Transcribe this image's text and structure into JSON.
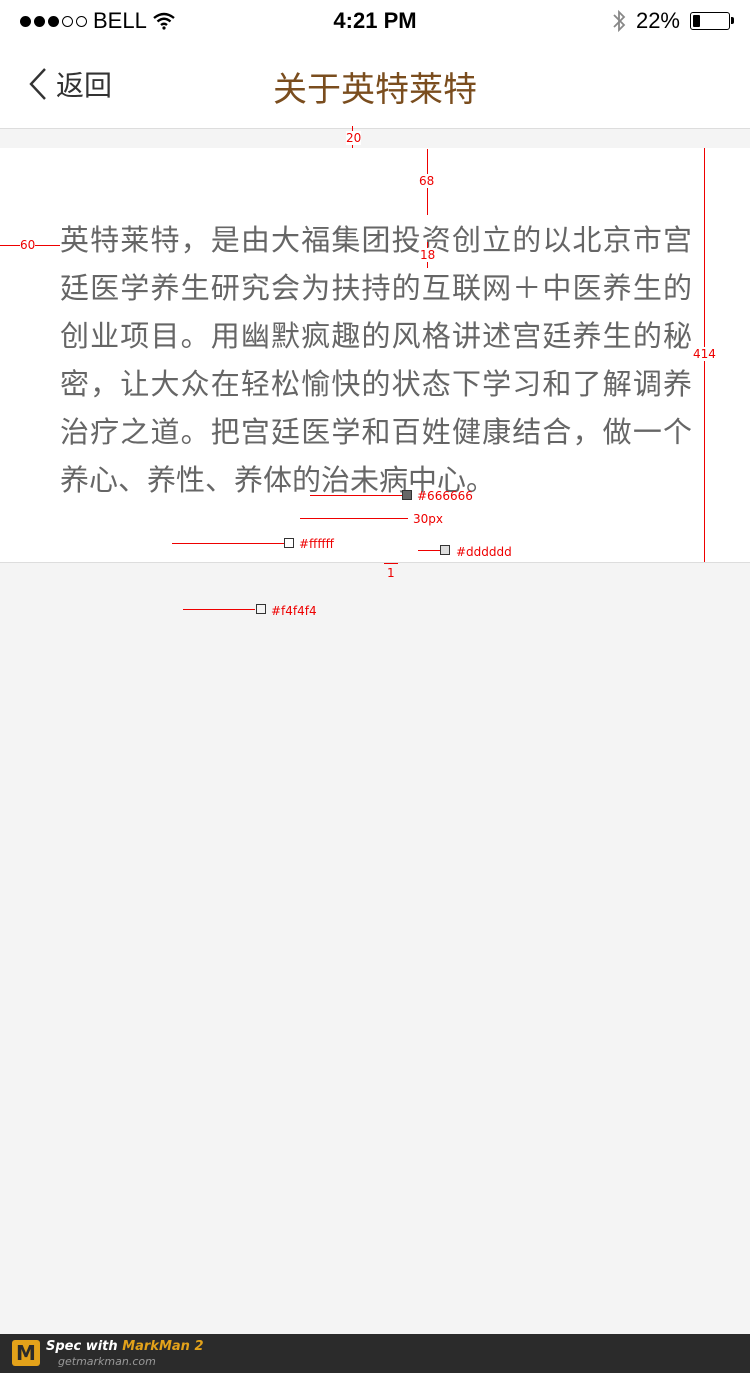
{
  "status_bar": {
    "carrier": "BELL",
    "time": "4:21 PM",
    "battery": "22%",
    "battery_level": 0.22,
    "icons": [
      "signal-dots-icon",
      "wifi-icon",
      "bluetooth-icon",
      "battery-icon"
    ]
  },
  "nav": {
    "back_label": "返回",
    "title": "关于英特莱特",
    "title_color": "#7a4d1e"
  },
  "main": {
    "description": "英特莱特，是由大福集团投资创立的以北京市宫廷医学养生研究会为扶持的互联网＋中医养生的创业项目。用幽默疯趣的风格讲述宫廷养生的秘密，让大众在轻松愉快的状态下学习和了解调养治疗之道。把宫廷医学和百姓健康结合，做一个养心、养性、养体的治未病中心。"
  },
  "annotations": {
    "gap_top": "20",
    "pad_top": "68",
    "line_gap": "18",
    "pad_left": "60",
    "card_height": "414",
    "text_color": "#666666",
    "font_size": "30px",
    "card_bg": "#ffffff",
    "border_color": "#dddddd",
    "border_width": "1",
    "page_bg": "#f4f4f4"
  },
  "footer": {
    "brand_prefix": "Spec with ",
    "brand_name": "MarkMan 2",
    "url": "getmarkman.com"
  }
}
